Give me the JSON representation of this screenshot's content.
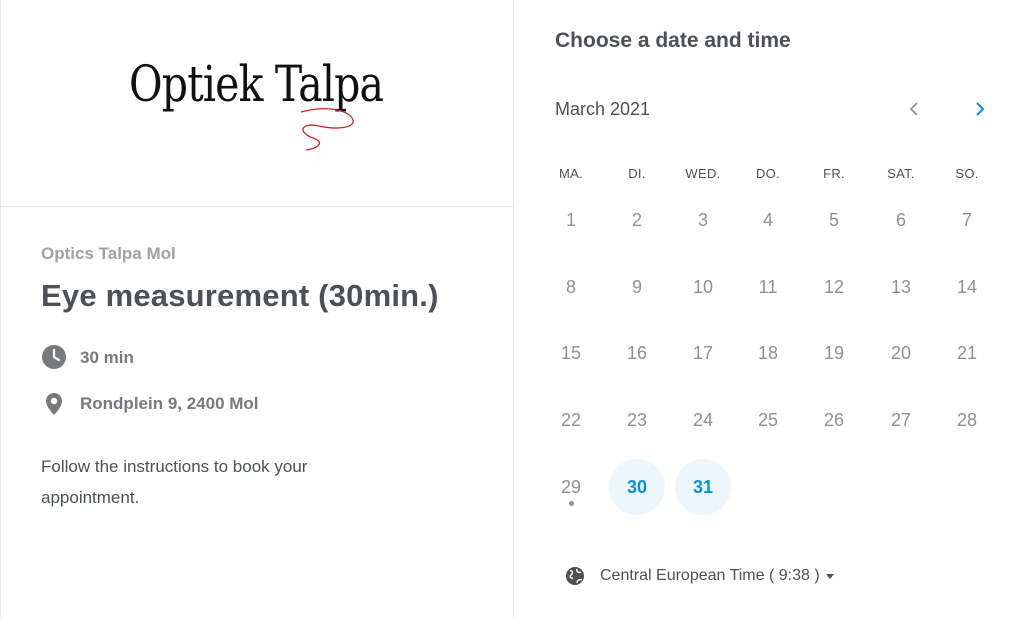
{
  "logo": {
    "text": "Optiek Talpa"
  },
  "event": {
    "organizer": "Optics Talpa Mol",
    "title": "Eye measurement (30min.)",
    "duration": "30 min",
    "location": "Rondplein 9, 2400 Mol",
    "description": "Follow the instructions to book your appointment."
  },
  "scheduler": {
    "heading": "Choose a date and time",
    "month": "March 2021",
    "weekdays": [
      "MA.",
      "DI.",
      "WED.",
      "DO.",
      "FR.",
      "SAT.",
      "SO."
    ],
    "days": [
      "1",
      "2",
      "3",
      "4",
      "5",
      "6",
      "7",
      "8",
      "9",
      "10",
      "11",
      "12",
      "13",
      "14",
      "15",
      "16",
      "17",
      "18",
      "19",
      "20",
      "21",
      "22",
      "23",
      "24",
      "25",
      "26",
      "27",
      "28",
      "29",
      "30",
      "31"
    ],
    "available_days": [
      "30",
      "31"
    ],
    "today": "29",
    "timezone": "Central European Time ( 9:38 )"
  },
  "colors": {
    "accent": "#0a8fe0",
    "available_bg": "#eef6fd",
    "text": "#4d5055",
    "muted": "#8e9094",
    "logo_red": "#d0232a"
  },
  "icons": {
    "prev": "chevron-left-icon",
    "next": "chevron-right-icon",
    "duration": "clock-icon",
    "location": "map-pin-icon",
    "timezone": "globe-icon"
  }
}
